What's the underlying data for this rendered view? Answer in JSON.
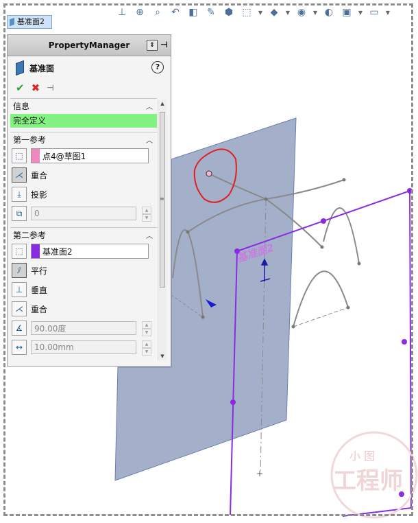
{
  "tab": {
    "label": "基准面2"
  },
  "property_manager": {
    "header_title": "PropertyManager",
    "feature_title": "基准面",
    "help_label": "?",
    "info_section": {
      "title": "信息",
      "status": "完全定义"
    },
    "first_reference": {
      "title": "第一参考",
      "selection": "点4@草图1",
      "selection_color": "#ee88c0",
      "options": {
        "coincident": "重合",
        "project": "投影"
      },
      "value": "0"
    },
    "second_reference": {
      "title": "第二参考",
      "selection": "基准面2",
      "selection_color": "#8a2be2",
      "options": {
        "parallel": "平行",
        "perpendicular": "垂直",
        "coincident": "重合"
      },
      "angle_value": "90.00度",
      "distance_value": "10.00mm"
    }
  },
  "viewport": {
    "plane_label": "基准面2",
    "watermark_text": "工程师",
    "watermark_small": "小  图",
    "plane_color": "#9aa6c4",
    "selected_plane_color": "#8a2be2"
  }
}
